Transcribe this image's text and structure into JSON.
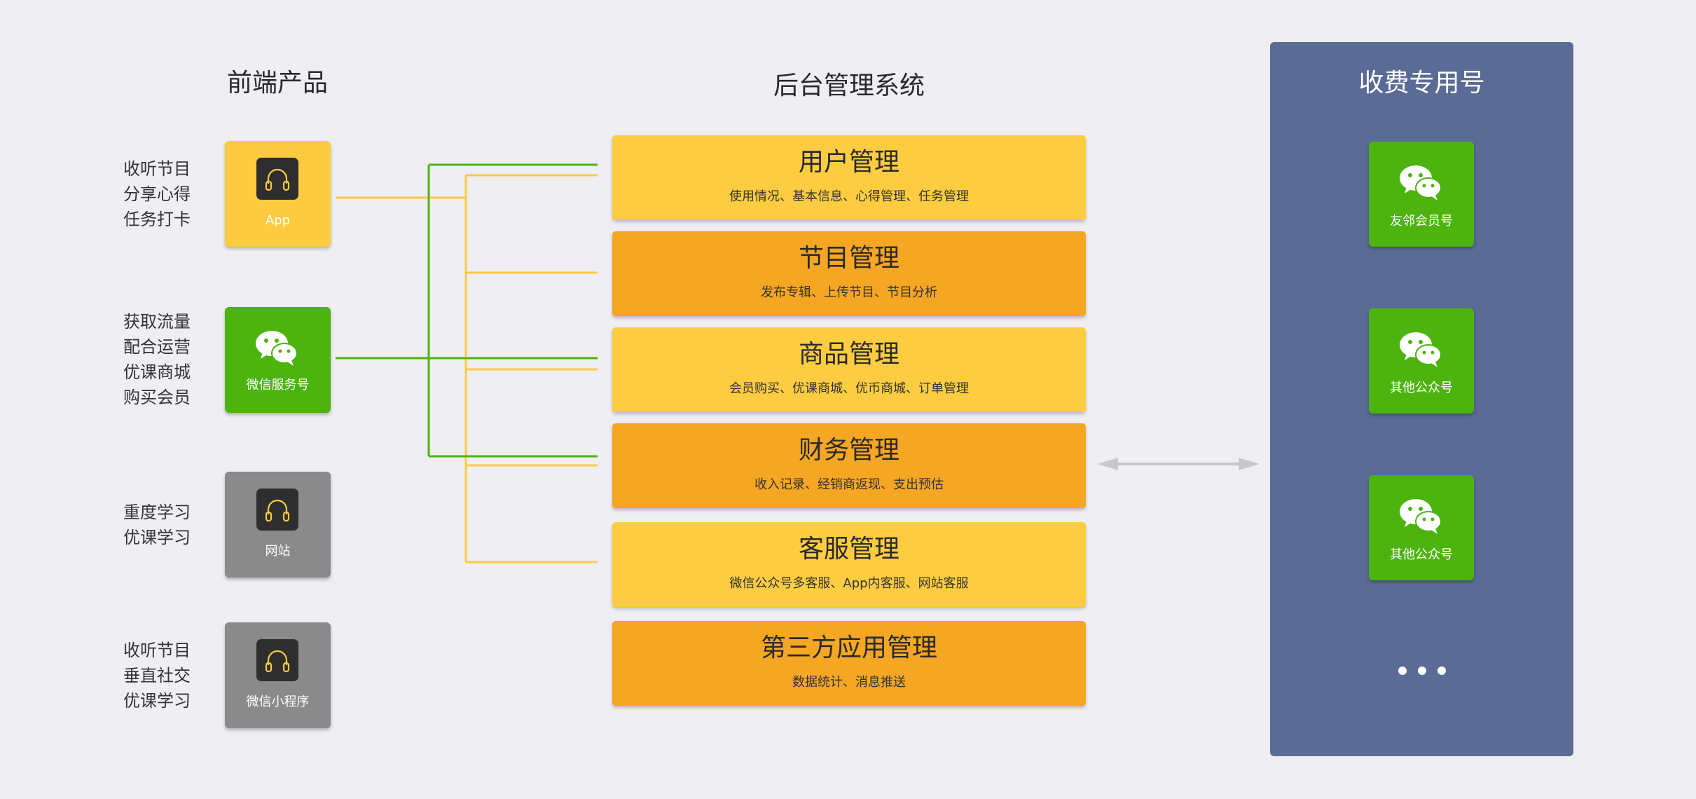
{
  "headings": {
    "front": "前端产品",
    "backend": "后台管理系统",
    "paid": "收费专用号"
  },
  "products": [
    {
      "desc": [
        "收听节目",
        "分享心得",
        "任务打卡"
      ],
      "label": "App",
      "icon": "headphones-icon",
      "color": "#fccb40"
    },
    {
      "desc": [
        "获取流量",
        "配合运营",
        "优课商城",
        "购买会员"
      ],
      "label": "微信服务号",
      "icon": "wechat-icon",
      "color": "#4cb30f"
    },
    {
      "desc": [
        "重度学习",
        "优课学习"
      ],
      "label": "网站",
      "icon": "headphones-icon",
      "color": "#8a8a8a"
    },
    {
      "desc": [
        "收听节目",
        "垂直社交",
        "优课学习"
      ],
      "label": "微信小程序",
      "icon": "headphones-icon",
      "color": "#8a8a8a"
    }
  ],
  "management": [
    {
      "title": "用户管理",
      "subtitle": "使用情况、基本信息、心得管理、任务管理"
    },
    {
      "title": "节目管理",
      "subtitle": "发布专辑、上传节目、节目分析"
    },
    {
      "title": "商品管理",
      "subtitle": "会员购买、优课商城、优币商城、订单管理"
    },
    {
      "title": "财务管理",
      "subtitle": "收入记录、经销商返现、支出预估"
    },
    {
      "title": "客服管理",
      "subtitle": "微信公众号多客服、App内客服、网站客服"
    },
    {
      "title": "第三方应用管理",
      "subtitle": "数据统计、消息推送"
    }
  ],
  "paid_accounts": [
    {
      "label": "友邻会员号",
      "icon": "wechat-icon"
    },
    {
      "label": "其他公众号",
      "icon": "wechat-icon"
    },
    {
      "label": "其他公众号",
      "icon": "wechat-icon"
    }
  ],
  "colors": {
    "background": "#efeef3",
    "yellow_block": "#fdcc40",
    "orange_block": "#f5a623",
    "green": "#4cb30f",
    "gray": "#8a8a8a",
    "panel": "#5a6b96",
    "connector_yellow": "#fccb40",
    "connector_green": "#4cb30f",
    "arrow": "#c8c8c8"
  }
}
